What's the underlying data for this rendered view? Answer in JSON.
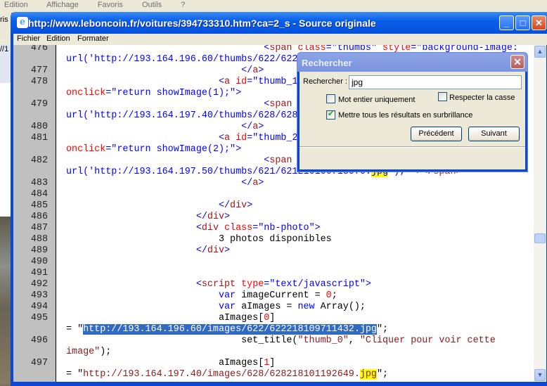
{
  "browser_menu": [
    "Edition",
    "Affichage",
    "Favoris",
    "Outils",
    "?"
  ],
  "left_strip": {
    "top_text": "ris",
    "addr_text": "//1"
  },
  "window": {
    "title": "http://www.leboncoin.fr/voitures/394733310.htm?ca=2_s - Source originale",
    "controls": {
      "minimize": "_",
      "maximize": "□",
      "close": "✕"
    },
    "menu": [
      "Fichier",
      "Edition",
      "Formater"
    ]
  },
  "colors": {
    "titlebar": "#0a5fe8",
    "highlight": "#ffff00",
    "selection": "#316ac5",
    "tag": "#0000ff",
    "attribute": "#ff0000",
    "string": "#8b1a1a"
  },
  "code_rows": [
    {
      "n": "476",
      "seg": [
        [
          "                                   ",
          "p"
        ],
        [
          "<",
          "t"
        ],
        [
          "span ",
          "e"
        ],
        [
          "class",
          "a"
        ],
        [
          "=",
          "t"
        ],
        [
          "\"thumbs\" ",
          "v"
        ],
        [
          "style",
          "a"
        ],
        [
          "=",
          "t"
        ],
        [
          "\"background-image:",
          "v"
        ]
      ]
    },
    {
      "n": "",
      "seg": [
        [
          "url('http://193.164.196.60/thumbs/622/622",
          "v"
        ]
      ]
    },
    {
      "n": "477",
      "seg": [
        [
          "                               ",
          "p"
        ],
        [
          "</",
          "t"
        ],
        [
          "a",
          "e"
        ],
        [
          ">",
          "t"
        ]
      ]
    },
    {
      "n": "478",
      "seg": [
        [
          "                           ",
          "p"
        ],
        [
          "<",
          "t"
        ],
        [
          "a ",
          "e"
        ],
        [
          "id",
          "a"
        ],
        [
          "=",
          "t"
        ],
        [
          "\"thumb_1",
          "v"
        ]
      ]
    },
    {
      "n": "",
      "seg": [
        [
          "onclick",
          "a"
        ],
        [
          "=",
          "t"
        ],
        [
          "\"return showImage(1);\">",
          "v"
        ]
      ]
    },
    {
      "n": "479",
      "seg": [
        [
          "                                   ",
          "p"
        ],
        [
          "<",
          "t"
        ],
        [
          "span",
          "e"
        ]
      ]
    },
    {
      "n": "",
      "seg": [
        [
          "url('http://193.164.197.40/thumbs/628/628",
          "v"
        ]
      ]
    },
    {
      "n": "480",
      "seg": [
        [
          "                               ",
          "p"
        ],
        [
          "</",
          "t"
        ],
        [
          "a",
          "e"
        ],
        [
          ">",
          "t"
        ]
      ]
    },
    {
      "n": "481",
      "seg": [
        [
          "                           ",
          "p"
        ],
        [
          "<",
          "t"
        ],
        [
          "a ",
          "e"
        ],
        [
          "id",
          "a"
        ],
        [
          "=",
          "t"
        ],
        [
          "\"thumb_2",
          "v"
        ]
      ]
    },
    {
      "n": "",
      "seg": [
        [
          "onclick",
          "a"
        ],
        [
          "=",
          "t"
        ],
        [
          "\"return showImage(2);\">",
          "v"
        ]
      ]
    },
    {
      "n": "482",
      "seg": [
        [
          "                                   ",
          "p"
        ],
        [
          "<",
          "t"
        ],
        [
          "span",
          "e"
        ]
      ]
    },
    {
      "n": "",
      "seg": [
        [
          "url('http://193.164.197.50/thumbs/621/621210106713070.",
          "v"
        ],
        [
          "jpg",
          "v hl"
        ],
        [
          "'); \">",
          "v"
        ],
        [
          "</",
          "t"
        ],
        [
          "span",
          "e"
        ],
        [
          ">",
          "t"
        ]
      ]
    },
    {
      "n": "483",
      "seg": [
        [
          "                               ",
          "p"
        ],
        [
          "</",
          "t"
        ],
        [
          "a",
          "e"
        ],
        [
          ">",
          "t"
        ]
      ]
    },
    {
      "n": "484",
      "seg": []
    },
    {
      "n": "485",
      "seg": [
        [
          "                           ",
          "p"
        ],
        [
          "</",
          "t"
        ],
        [
          "div",
          "e"
        ],
        [
          ">",
          "t"
        ]
      ]
    },
    {
      "n": "486",
      "seg": [
        [
          "                       ",
          "p"
        ],
        [
          "</",
          "t"
        ],
        [
          "div",
          "e"
        ],
        [
          ">",
          "t"
        ]
      ]
    },
    {
      "n": "487",
      "seg": [
        [
          "                       ",
          "p"
        ],
        [
          "<",
          "t"
        ],
        [
          "div ",
          "e"
        ],
        [
          "class",
          "a"
        ],
        [
          "=",
          "t"
        ],
        [
          "\"nb-photo\">",
          "v"
        ]
      ]
    },
    {
      "n": "488",
      "seg": [
        [
          "                           3 photos disponibles",
          "p"
        ]
      ]
    },
    {
      "n": "489",
      "seg": [
        [
          "                       ",
          "p"
        ],
        [
          "</",
          "t"
        ],
        [
          "div",
          "e"
        ],
        [
          ">",
          "t"
        ]
      ]
    },
    {
      "n": "490",
      "seg": []
    },
    {
      "n": "491",
      "seg": []
    },
    {
      "n": "492",
      "seg": [
        [
          "                       ",
          "p"
        ],
        [
          "<",
          "t"
        ],
        [
          "script ",
          "e"
        ],
        [
          "type",
          "a"
        ],
        [
          "=",
          "t"
        ],
        [
          "\"text/javascript\">",
          "v"
        ]
      ]
    },
    {
      "n": "493",
      "seg": [
        [
          "                           ",
          "p"
        ],
        [
          "var ",
          "k"
        ],
        [
          "imageCurrent = ",
          "p"
        ],
        [
          "0",
          "n"
        ],
        [
          ";",
          "p"
        ]
      ]
    },
    {
      "n": "494",
      "seg": [
        [
          "                           ",
          "p"
        ],
        [
          "var ",
          "k"
        ],
        [
          "aImages = ",
          "p"
        ],
        [
          "new ",
          "k"
        ],
        [
          "Array();",
          "p"
        ]
      ]
    },
    {
      "n": "495",
      "seg": [
        [
          "                           aImages[",
          "p"
        ],
        [
          "0",
          "n"
        ],
        [
          "]",
          "p"
        ]
      ]
    },
    {
      "n": "",
      "seg": [
        [
          "= \"",
          "p"
        ],
        [
          "http://193.164.196.60/images/622/622218109711432.jpg",
          "sel"
        ],
        [
          "\";",
          "p"
        ]
      ]
    },
    {
      "n": "496",
      "seg": [
        [
          "                               set_title(",
          "p"
        ],
        [
          "\"thumb_0\"",
          "s"
        ],
        [
          ", ",
          "p"
        ],
        [
          "\"Cliquer pour voir cette",
          "s"
        ]
      ]
    },
    {
      "n": "",
      "seg": [
        [
          "image\"",
          "s"
        ],
        [
          ");",
          "p"
        ]
      ]
    },
    {
      "n": "497",
      "seg": [
        [
          "                           aImages[",
          "p"
        ],
        [
          "1",
          "n"
        ],
        [
          "]",
          "p"
        ]
      ]
    },
    {
      "n": "",
      "seg": [
        [
          "= \"",
          "p"
        ],
        [
          "http://193.164.197.40/images/628/628218101192649.",
          "s"
        ],
        [
          "jpg",
          "s hl"
        ],
        [
          "\";",
          "p"
        ]
      ]
    }
  ],
  "dialog": {
    "title": "Rechercher",
    "close": "✕",
    "search_label": "Rechercher :",
    "search_value": "jpg",
    "whole_word": {
      "label": "Mot entier uniquement",
      "checked": false
    },
    "match_case": {
      "label": "Respecter la casse",
      "checked": false
    },
    "highlight_all": {
      "label": "Mettre tous les résultats en surbrillance",
      "checked": true
    },
    "prev_button": "Précédent",
    "next_button": "Suivant"
  },
  "scrollbar": {
    "up": "▲",
    "down": "▼"
  }
}
